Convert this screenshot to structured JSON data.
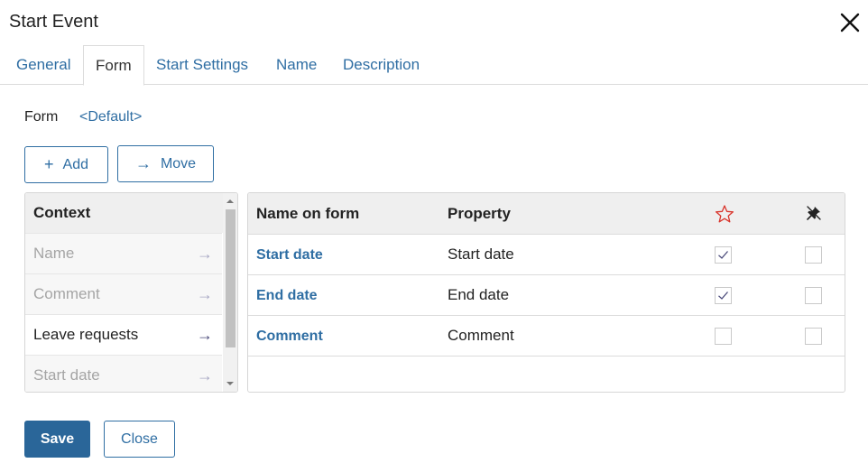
{
  "dialog": {
    "title": "Start Event"
  },
  "tabs": [
    {
      "label": "General"
    },
    {
      "label": "Form"
    },
    {
      "label": "Start Settings"
    },
    {
      "label": "Name"
    },
    {
      "label": "Description"
    }
  ],
  "form": {
    "label": "Form",
    "value": "<Default>"
  },
  "toolbar": {
    "add_label": "Add",
    "add_glyph": "+",
    "move_label": "Move",
    "move_glyph": "→"
  },
  "context": {
    "header": "Context",
    "arrow": "→",
    "items": [
      {
        "label": "Name",
        "state": "disabled"
      },
      {
        "label": "Comment",
        "state": "disabled"
      },
      {
        "label": "Leave requests",
        "state": "enabled"
      },
      {
        "label": "Start date",
        "state": "disabled"
      }
    ]
  },
  "grid": {
    "headers": {
      "name": "Name on form",
      "property": "Property",
      "required_icon": "star-icon",
      "readonly_icon": "pin-icon"
    },
    "rows": [
      {
        "name": "Start date",
        "property": "Start date",
        "required": true,
        "readonly": false
      },
      {
        "name": "End date",
        "property": "End date",
        "required": true,
        "readonly": false
      },
      {
        "name": "Comment",
        "property": "Comment",
        "required": false,
        "readonly": false
      }
    ]
  },
  "footer": {
    "save_label": "Save",
    "close_label": "Close"
  },
  "colors": {
    "accent": "#2f6ea3",
    "primary_button": "#2a6699",
    "star": "#d9342b"
  }
}
